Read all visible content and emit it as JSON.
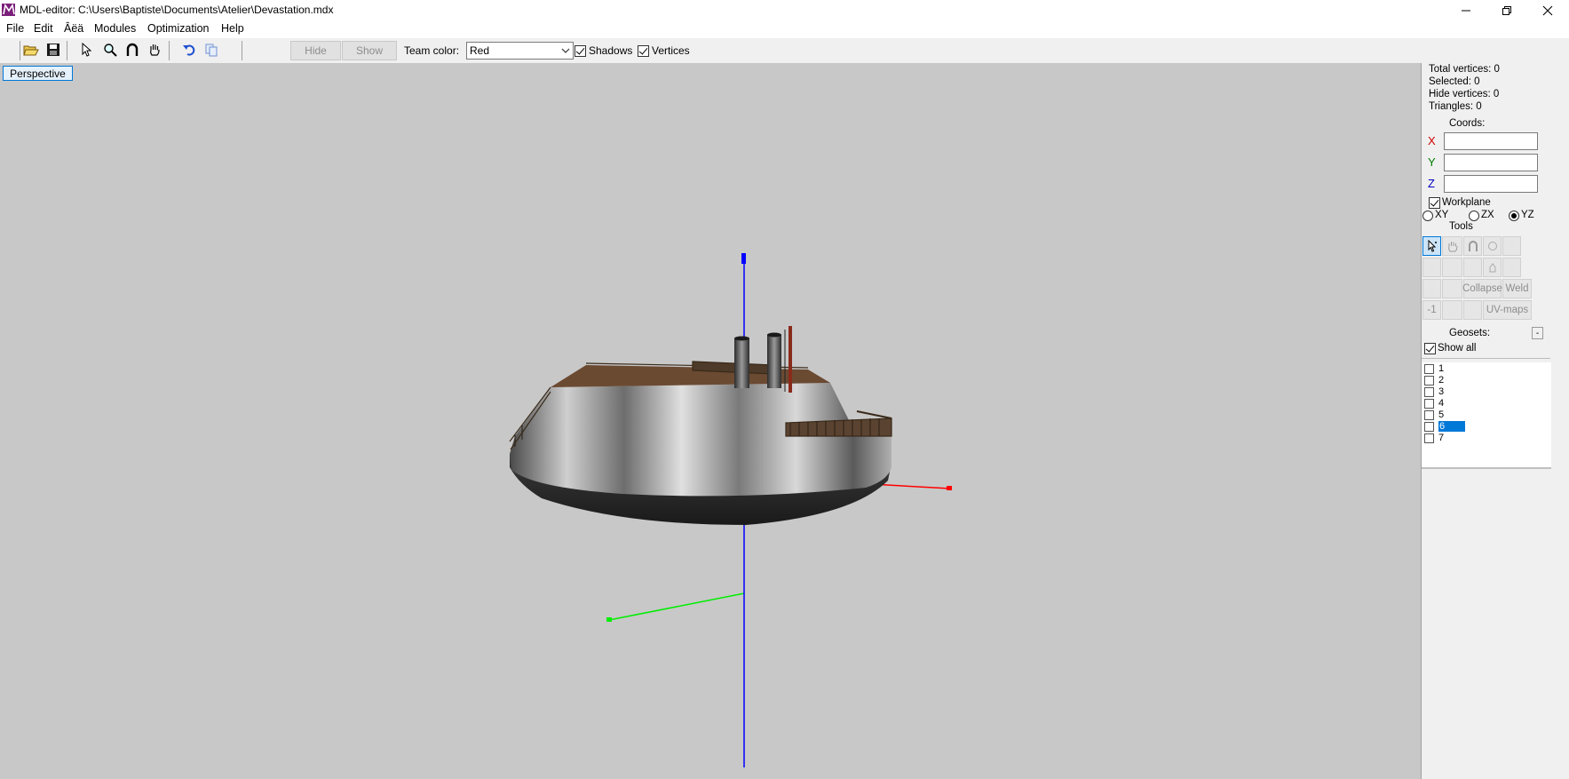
{
  "window": {
    "title": "MDL-editor: C:\\Users\\Baptiste\\Documents\\Atelier\\Devastation.mdx"
  },
  "menu": [
    "File",
    "Edit",
    "Âëä",
    "Modules",
    "Optimization",
    "Help"
  ],
  "toolbar": {
    "hide_label": "Hide",
    "show_label": "Show",
    "team_color_label": "Team color:",
    "team_color_value": "Red",
    "shadows_label": "Shadows",
    "vertices_label": "Vertices"
  },
  "viewport": {
    "mode_label": "Perspective",
    "axis_colors": {
      "x": "#ff0000",
      "y": "#00dd00",
      "z": "#0000ff"
    },
    "background": "#c8c8c8"
  },
  "stats": {
    "total_vertices": "Total vertices: 0",
    "selected": "Selected: 0",
    "hide_vertices": "Hide vertices: 0",
    "triangles": "Triangles: 0"
  },
  "coords": {
    "title": "Coords:",
    "x_label": "X",
    "y_label": "Y",
    "z_label": "Z",
    "x_value": "",
    "y_value": "",
    "z_value": "",
    "label_colors": {
      "x": "#d00000",
      "y": "#008000",
      "z": "#0000c0"
    }
  },
  "workplane": {
    "label": "Workplane",
    "planes": [
      "XY",
      "ZX",
      "YZ"
    ],
    "selected": "YZ"
  },
  "tools": {
    "title": "Tools",
    "collapse_label": "Collapse",
    "weld_label": "Weld",
    "minus_one_label": "-1",
    "uv_maps_label": "UV-maps"
  },
  "geosets": {
    "title": "Geosets:",
    "collapse_btn": "-",
    "show_all_label": "Show all",
    "items": [
      "1",
      "2",
      "3",
      "4",
      "5",
      "6",
      "7"
    ],
    "selected": "6"
  }
}
